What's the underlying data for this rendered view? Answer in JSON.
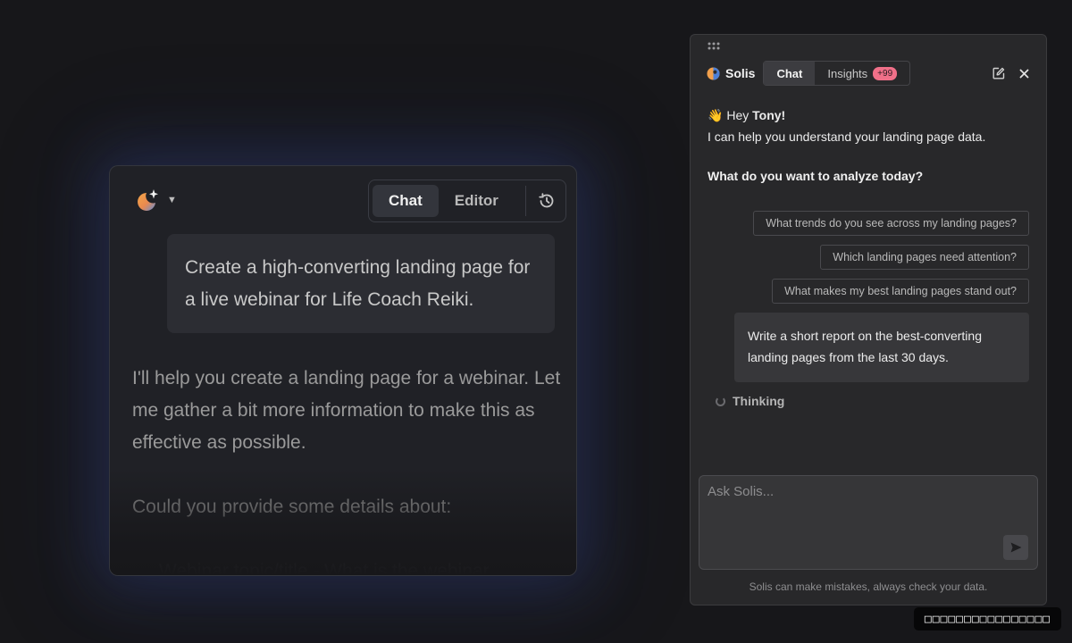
{
  "left_chat": {
    "tabs": [
      {
        "label": "Chat",
        "active": true
      },
      {
        "label": "Editor",
        "active": false
      }
    ],
    "user_message": "Create a high-converting landing page for a live webinar for Life Coach Reiki.",
    "assistant_paragraph_1": "I'll help you create a landing page for a webinar. Let me gather a bit more information to make this as effective as possible.",
    "assistant_paragraph_2": "Could you provide some details about:",
    "assistant_bullet_partial": "Webinar topic/title - What is the webinar"
  },
  "solis": {
    "brand": "Solis",
    "tabs": [
      {
        "label": "Chat",
        "active": true
      },
      {
        "label": "Insights",
        "active": false,
        "badge": "+99"
      }
    ],
    "greeting_emoji": "👋",
    "greeting_prefix": "Hey",
    "user_name": "Tony!",
    "intro": "I can help you understand your landing page data.",
    "question": "What do you want to analyze today?",
    "suggestions": [
      "What trends do you see across my landing pages?",
      "Which landing pages need attention?",
      "What makes my best landing pages stand out?"
    ],
    "user_message": "Write a short report on the best-converting landing pages from the last 30 days.",
    "status": "Thinking",
    "input_placeholder": "Ask Solis...",
    "disclaimer": "Solis can make mistakes, always check your data."
  },
  "toast": {
    "text": "□□□□□□□□□□□□□□□□"
  },
  "colors": {
    "background": "#17171a",
    "left_card": "#202126",
    "panel": "#28282a",
    "badge": "#f07089"
  }
}
